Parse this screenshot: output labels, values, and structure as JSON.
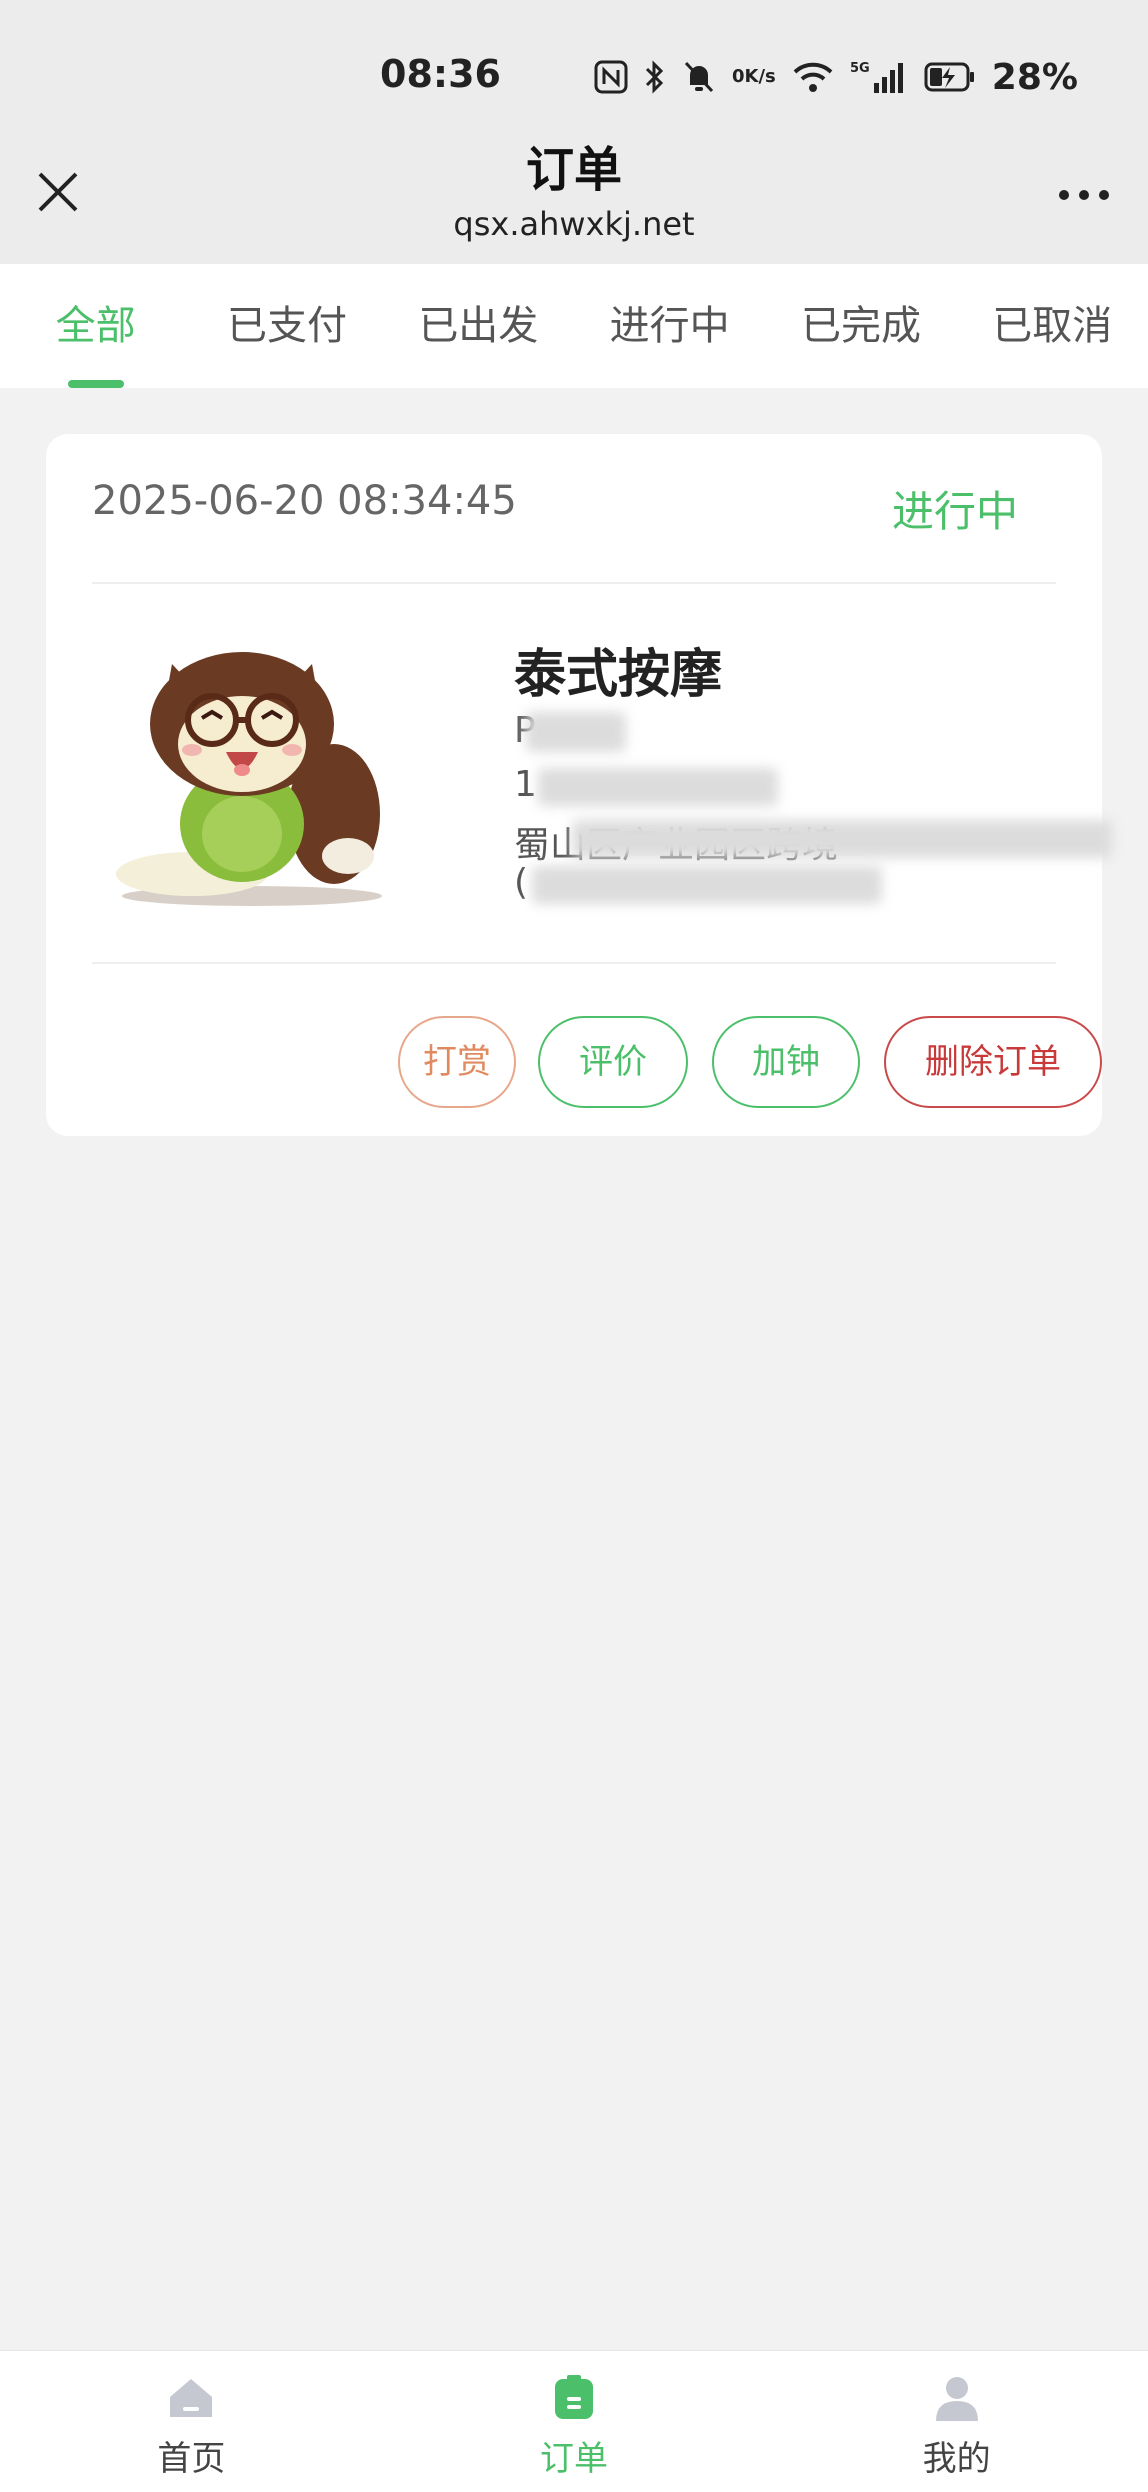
{
  "status_bar": {
    "time": "08:36",
    "net_speed_value": "0",
    "net_speed_unit": "K/s",
    "network": "5G",
    "battery": "28%"
  },
  "header": {
    "title": "订单",
    "url": "qsx.ahwxkj.net"
  },
  "tabs": [
    {
      "label": "全部",
      "active": true
    },
    {
      "label": "已支付",
      "active": false
    },
    {
      "label": "已出发",
      "active": false
    },
    {
      "label": "进行中",
      "active": false
    },
    {
      "label": "已完成",
      "active": false
    },
    {
      "label": "已取消",
      "active": false
    }
  ],
  "order": {
    "time": "2025-06-20 08:34:45",
    "status": "进行中",
    "service_name": "泰式按摩",
    "name_visible": "P",
    "phone_visible": "1",
    "address_visible": "蜀山区产业园区跨境",
    "address_line2_visible": "(",
    "buttons": {
      "reward": "打赏",
      "review": "评价",
      "add_clock": "加钟",
      "delete": "删除订单"
    }
  },
  "bottom_nav": [
    {
      "label": "首页",
      "icon": "home-icon",
      "active": false
    },
    {
      "label": "订单",
      "icon": "order-icon",
      "active": true
    },
    {
      "label": "我的",
      "icon": "user-icon",
      "active": false
    }
  ],
  "colors": {
    "accent": "#4cbf6a",
    "reward": "#e08a5f",
    "delete": "#c83a3a"
  }
}
